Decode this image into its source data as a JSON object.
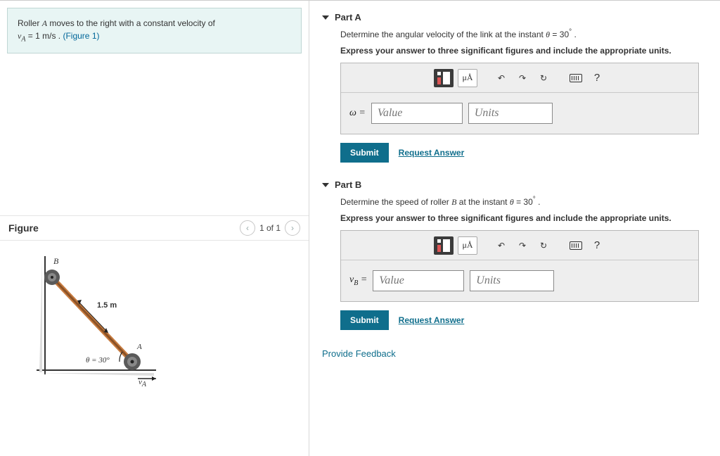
{
  "problem": {
    "pre": "Roller ",
    "var1": "A",
    "mid1": " moves to the right with a constant velocity of ",
    "eq_lhs": "v",
    "eq_sub": "A",
    "eq_rhs": " = 1 m/s .",
    "figlink": "(Figure 1)"
  },
  "figure": {
    "title": "Figure",
    "pager": "1 of 1",
    "diagram": {
      "label_B": "B",
      "length": "1.5 m",
      "angle_label": "θ = 30°",
      "label_A": "A",
      "vA_label": "v",
      "vA_sub": "A"
    }
  },
  "partA": {
    "title": "Part A",
    "question_pre": "Determine the angular velocity of the link at the instant ",
    "question_var": "θ",
    "question_eq": " = 30",
    "question_deg": "°",
    "question_post": " .",
    "instruction": "Express your answer to three significant figures and include the appropriate units.",
    "label": "ω =",
    "value_ph": "Value",
    "units_ph": "Units",
    "submit": "Submit",
    "request": "Request Answer"
  },
  "partB": {
    "title": "Part B",
    "question_pre": "Determine the speed of roller ",
    "question_var1": "B",
    "question_mid": " at the instant ",
    "question_var2": "θ",
    "question_eq": " = 30",
    "question_deg": "°",
    "question_post": " .",
    "instruction": "Express your answer to three significant figures and include the appropriate units.",
    "label_v": "v",
    "label_sub": "B",
    "label_post": " = ",
    "value_ph": "Value",
    "units_ph": "Units",
    "submit": "Submit",
    "request": "Request Answer"
  },
  "toolbar": {
    "muA": "μÅ",
    "help": "?"
  },
  "feedback": "Provide Feedback"
}
